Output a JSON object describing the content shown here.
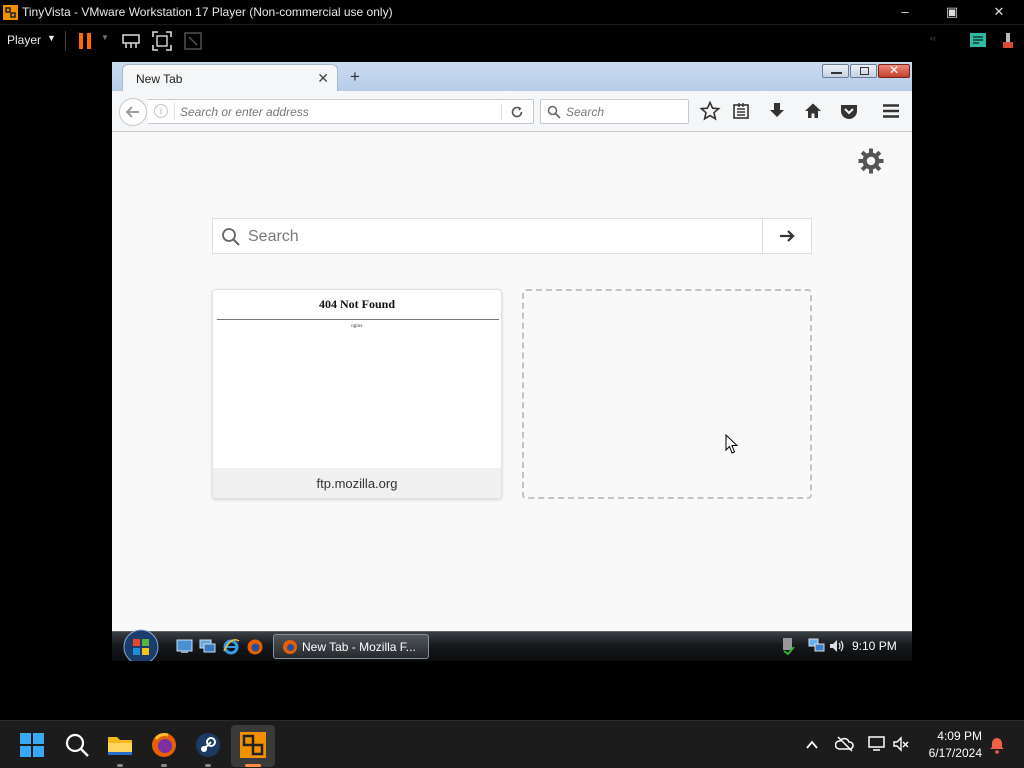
{
  "vmware": {
    "title": "TinyVista - VMware Workstation 17 Player (Non-commercial use only)",
    "player_menu": "Player",
    "accent_pause": "#ff6a00"
  },
  "firefox": {
    "tab_title": "New Tab",
    "address_placeholder": "Search or enter address",
    "search_placeholder": "Search",
    "toolbar_icons": [
      "star-icon",
      "reading-list-icon",
      "download-icon",
      "home-icon",
      "pocket-icon",
      "menu-icon"
    ]
  },
  "newtab": {
    "search_placeholder": "Search",
    "tiles": [
      {
        "thumbnail_title": "404 Not Found",
        "thumbnail_footer": "nginx",
        "caption": "ftp.mozilla.org"
      }
    ]
  },
  "vista_taskbar": {
    "task_label": "New Tab - Mozilla F...",
    "clock": "9:10 PM"
  },
  "windows11_taskbar": {
    "time": "4:09 PM",
    "date": "6/17/2024",
    "pinned_apps": [
      "start-icon",
      "search-icon",
      "file-explorer-icon",
      "firefox-icon",
      "steam-icon",
      "vmware-icon"
    ]
  }
}
